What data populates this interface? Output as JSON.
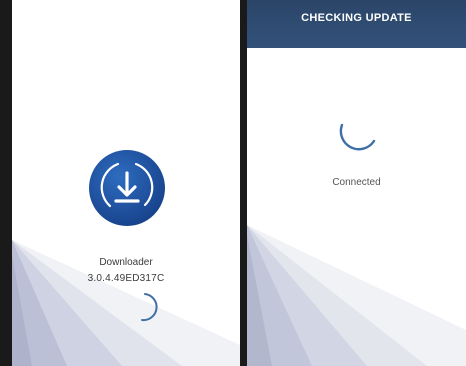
{
  "left_screen": {
    "app_name": "Downloader",
    "version": "3.0.4.49ED317C",
    "icon": "download-icon"
  },
  "right_screen": {
    "header_title": "CHECKING UPDATE",
    "status": "Connected"
  },
  "colors": {
    "brand_blue": "#1d4fa0",
    "header_blue": "#2b4568",
    "spinner_blue": "#3e6fa6"
  }
}
